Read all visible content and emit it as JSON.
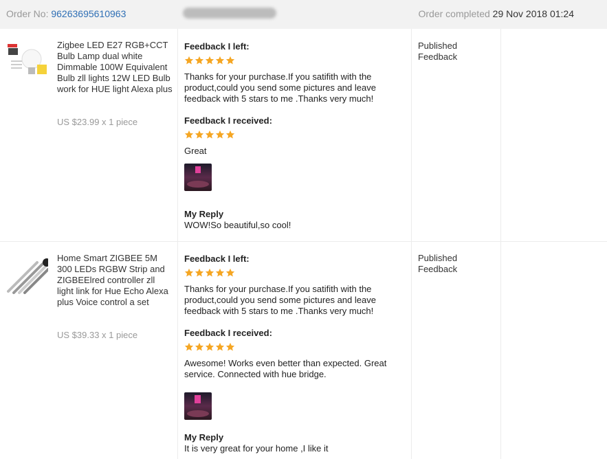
{
  "header": {
    "order_label": "Order No: ",
    "order_number": "96263695610963",
    "status_label": "Order completed ",
    "status_date": "29 Nov 2018 01:24"
  },
  "labels": {
    "feedback_left": "Feedback I left:",
    "feedback_received": "Feedback I received:",
    "my_reply": "My Reply"
  },
  "colors": {
    "star": "#f5a623",
    "link": "#2f6fb5"
  },
  "items": [
    {
      "title": "Zigbee LED E27 RGB+CCT Bulb Lamp dual white Dimmable 100W Equivalent Bulb zll lights 12W LED Bulb work for HUE light Alexa plus",
      "price": "US $23.99 x 1 piece",
      "feedback_left_stars": 5,
      "feedback_left_text": "Thanks for your purchase.If you satifith with the product,could you send some pictures and leave feedback with 5 stars to me .Thanks very much!",
      "feedback_received_stars": 5,
      "feedback_received_text": "Great",
      "reply_text": "WOW!So beautiful,so cool!",
      "status": "Published Feedback",
      "thumb_icon": "bulb-product-image"
    },
    {
      "title": "Home Smart ZIGBEE 5M 300 LEDs RGBW Strip and ZIGBEElred controller zll light link for Hue Echo Alexa plus Voice control a set",
      "price": "US $39.33 x 1 piece",
      "feedback_left_stars": 5,
      "feedback_left_text": "Thanks for your purchase.If you satifith with the product,could you send some pictures and leave feedback with 5 stars to me .Thanks very much!",
      "feedback_received_stars": 5,
      "feedback_received_text": "Awesome! Works even better than expected. Great service. Connected with hue bridge.",
      "reply_text": "It is very great for your home ,I like it",
      "status": "Published Feedback",
      "thumb_icon": "led-strip-product-image"
    }
  ]
}
